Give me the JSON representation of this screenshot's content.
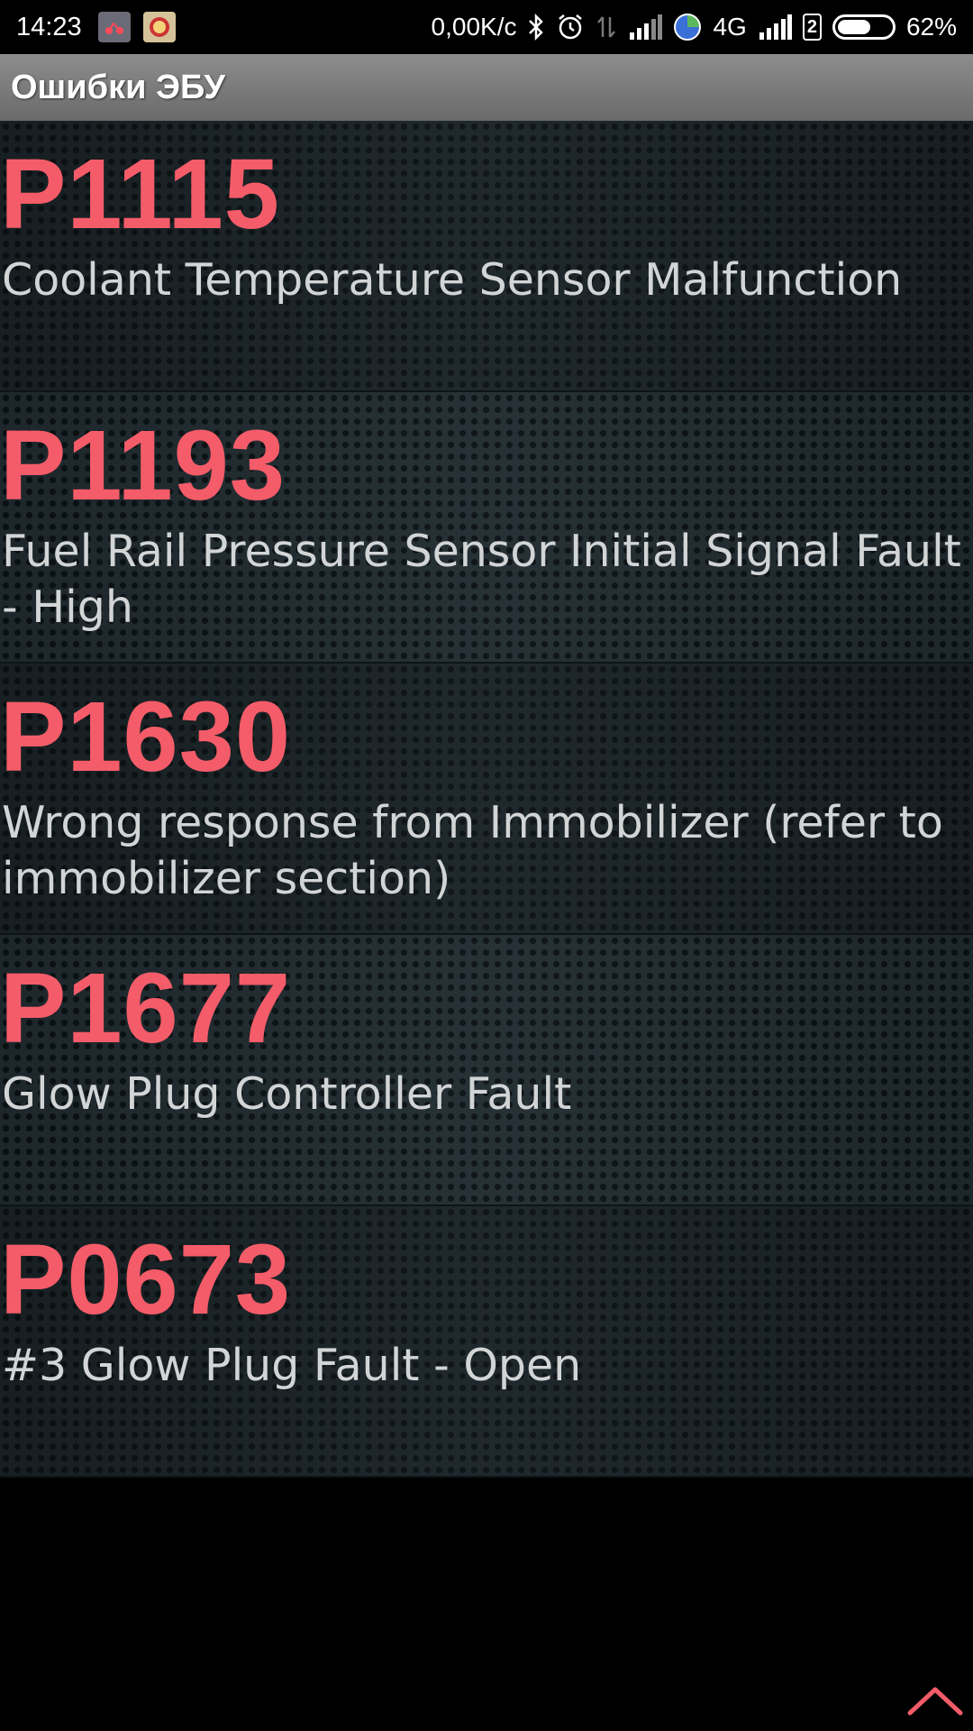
{
  "status_bar": {
    "time": "14:23",
    "net_speed": "0,00K/с",
    "network_type": "4G",
    "sim2_label": "2",
    "battery_percent_text": "62%",
    "battery_level": 0.62,
    "icons": [
      "notification-app-icon",
      "notification-app-icon-2",
      "bluetooth-icon",
      "alarm-icon",
      "data-transfer-icon",
      "signal-icon",
      "globe-icon",
      "signal-icon-2",
      "sim-icon",
      "battery-icon"
    ]
  },
  "header": {
    "title": "Ошибки ЭБУ"
  },
  "errors": [
    {
      "code": "P1115",
      "description": "Coolant Temperature Sensor Malfunction"
    },
    {
      "code": "P1193",
      "description": "Fuel Rail Pressure Sensor Initial Signal Fault - High"
    },
    {
      "code": "P1630",
      "description": "Wrong response from Immobilizer (refer to immobilizer section)"
    },
    {
      "code": "P1677",
      "description": "Glow Plug Controller Fault"
    },
    {
      "code": "P0673",
      "description": "#3 Glow Plug Fault - Open"
    }
  ],
  "colors": {
    "code_color": "#f45c69",
    "description_color": "#d2d5d6",
    "accent_arrow": "#f45c69"
  },
  "scroll_up_icon": "chevron-up-icon"
}
